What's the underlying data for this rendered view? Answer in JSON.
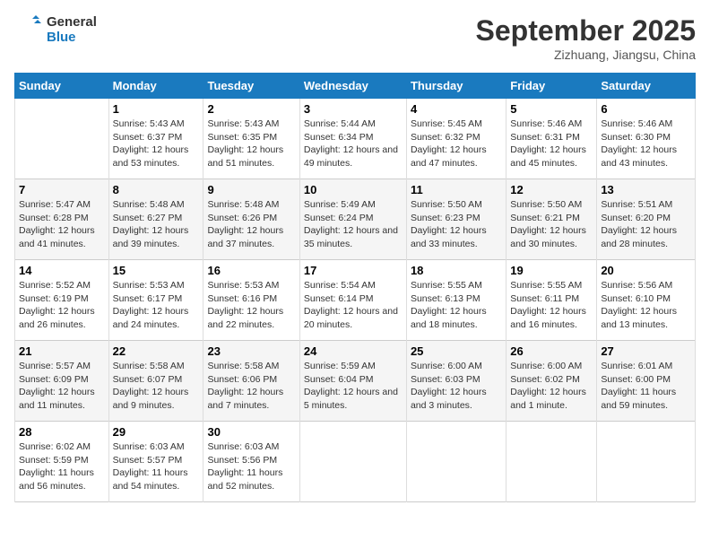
{
  "header": {
    "logo_line1": "General",
    "logo_line2": "Blue",
    "month_title": "September 2025",
    "location": "Zizhuang, Jiangsu, China"
  },
  "days_of_week": [
    "Sunday",
    "Monday",
    "Tuesday",
    "Wednesday",
    "Thursday",
    "Friday",
    "Saturday"
  ],
  "weeks": [
    [
      {
        "day": "",
        "sunrise": "",
        "sunset": "",
        "daylight": "",
        "empty": true
      },
      {
        "day": "1",
        "sunrise": "Sunrise: 5:43 AM",
        "sunset": "Sunset: 6:37 PM",
        "daylight": "Daylight: 12 hours and 53 minutes."
      },
      {
        "day": "2",
        "sunrise": "Sunrise: 5:43 AM",
        "sunset": "Sunset: 6:35 PM",
        "daylight": "Daylight: 12 hours and 51 minutes."
      },
      {
        "day": "3",
        "sunrise": "Sunrise: 5:44 AM",
        "sunset": "Sunset: 6:34 PM",
        "daylight": "Daylight: 12 hours and 49 minutes."
      },
      {
        "day": "4",
        "sunrise": "Sunrise: 5:45 AM",
        "sunset": "Sunset: 6:32 PM",
        "daylight": "Daylight: 12 hours and 47 minutes."
      },
      {
        "day": "5",
        "sunrise": "Sunrise: 5:46 AM",
        "sunset": "Sunset: 6:31 PM",
        "daylight": "Daylight: 12 hours and 45 minutes."
      },
      {
        "day": "6",
        "sunrise": "Sunrise: 5:46 AM",
        "sunset": "Sunset: 6:30 PM",
        "daylight": "Daylight: 12 hours and 43 minutes."
      }
    ],
    [
      {
        "day": "7",
        "sunrise": "Sunrise: 5:47 AM",
        "sunset": "Sunset: 6:28 PM",
        "daylight": "Daylight: 12 hours and 41 minutes."
      },
      {
        "day": "8",
        "sunrise": "Sunrise: 5:48 AM",
        "sunset": "Sunset: 6:27 PM",
        "daylight": "Daylight: 12 hours and 39 minutes."
      },
      {
        "day": "9",
        "sunrise": "Sunrise: 5:48 AM",
        "sunset": "Sunset: 6:26 PM",
        "daylight": "Daylight: 12 hours and 37 minutes."
      },
      {
        "day": "10",
        "sunrise": "Sunrise: 5:49 AM",
        "sunset": "Sunset: 6:24 PM",
        "daylight": "Daylight: 12 hours and 35 minutes."
      },
      {
        "day": "11",
        "sunrise": "Sunrise: 5:50 AM",
        "sunset": "Sunset: 6:23 PM",
        "daylight": "Daylight: 12 hours and 33 minutes."
      },
      {
        "day": "12",
        "sunrise": "Sunrise: 5:50 AM",
        "sunset": "Sunset: 6:21 PM",
        "daylight": "Daylight: 12 hours and 30 minutes."
      },
      {
        "day": "13",
        "sunrise": "Sunrise: 5:51 AM",
        "sunset": "Sunset: 6:20 PM",
        "daylight": "Daylight: 12 hours and 28 minutes."
      }
    ],
    [
      {
        "day": "14",
        "sunrise": "Sunrise: 5:52 AM",
        "sunset": "Sunset: 6:19 PM",
        "daylight": "Daylight: 12 hours and 26 minutes."
      },
      {
        "day": "15",
        "sunrise": "Sunrise: 5:53 AM",
        "sunset": "Sunset: 6:17 PM",
        "daylight": "Daylight: 12 hours and 24 minutes."
      },
      {
        "day": "16",
        "sunrise": "Sunrise: 5:53 AM",
        "sunset": "Sunset: 6:16 PM",
        "daylight": "Daylight: 12 hours and 22 minutes."
      },
      {
        "day": "17",
        "sunrise": "Sunrise: 5:54 AM",
        "sunset": "Sunset: 6:14 PM",
        "daylight": "Daylight: 12 hours and 20 minutes."
      },
      {
        "day": "18",
        "sunrise": "Sunrise: 5:55 AM",
        "sunset": "Sunset: 6:13 PM",
        "daylight": "Daylight: 12 hours and 18 minutes."
      },
      {
        "day": "19",
        "sunrise": "Sunrise: 5:55 AM",
        "sunset": "Sunset: 6:11 PM",
        "daylight": "Daylight: 12 hours and 16 minutes."
      },
      {
        "day": "20",
        "sunrise": "Sunrise: 5:56 AM",
        "sunset": "Sunset: 6:10 PM",
        "daylight": "Daylight: 12 hours and 13 minutes."
      }
    ],
    [
      {
        "day": "21",
        "sunrise": "Sunrise: 5:57 AM",
        "sunset": "Sunset: 6:09 PM",
        "daylight": "Daylight: 12 hours and 11 minutes."
      },
      {
        "day": "22",
        "sunrise": "Sunrise: 5:58 AM",
        "sunset": "Sunset: 6:07 PM",
        "daylight": "Daylight: 12 hours and 9 minutes."
      },
      {
        "day": "23",
        "sunrise": "Sunrise: 5:58 AM",
        "sunset": "Sunset: 6:06 PM",
        "daylight": "Daylight: 12 hours and 7 minutes."
      },
      {
        "day": "24",
        "sunrise": "Sunrise: 5:59 AM",
        "sunset": "Sunset: 6:04 PM",
        "daylight": "Daylight: 12 hours and 5 minutes."
      },
      {
        "day": "25",
        "sunrise": "Sunrise: 6:00 AM",
        "sunset": "Sunset: 6:03 PM",
        "daylight": "Daylight: 12 hours and 3 minutes."
      },
      {
        "day": "26",
        "sunrise": "Sunrise: 6:00 AM",
        "sunset": "Sunset: 6:02 PM",
        "daylight": "Daylight: 12 hours and 1 minute."
      },
      {
        "day": "27",
        "sunrise": "Sunrise: 6:01 AM",
        "sunset": "Sunset: 6:00 PM",
        "daylight": "Daylight: 11 hours and 59 minutes."
      }
    ],
    [
      {
        "day": "28",
        "sunrise": "Sunrise: 6:02 AM",
        "sunset": "Sunset: 5:59 PM",
        "daylight": "Daylight: 11 hours and 56 minutes."
      },
      {
        "day": "29",
        "sunrise": "Sunrise: 6:03 AM",
        "sunset": "Sunset: 5:57 PM",
        "daylight": "Daylight: 11 hours and 54 minutes."
      },
      {
        "day": "30",
        "sunrise": "Sunrise: 6:03 AM",
        "sunset": "Sunset: 5:56 PM",
        "daylight": "Daylight: 11 hours and 52 minutes."
      },
      {
        "day": "",
        "sunrise": "",
        "sunset": "",
        "daylight": "",
        "empty": true
      },
      {
        "day": "",
        "sunrise": "",
        "sunset": "",
        "daylight": "",
        "empty": true
      },
      {
        "day": "",
        "sunrise": "",
        "sunset": "",
        "daylight": "",
        "empty": true
      },
      {
        "day": "",
        "sunrise": "",
        "sunset": "",
        "daylight": "",
        "empty": true
      }
    ]
  ]
}
